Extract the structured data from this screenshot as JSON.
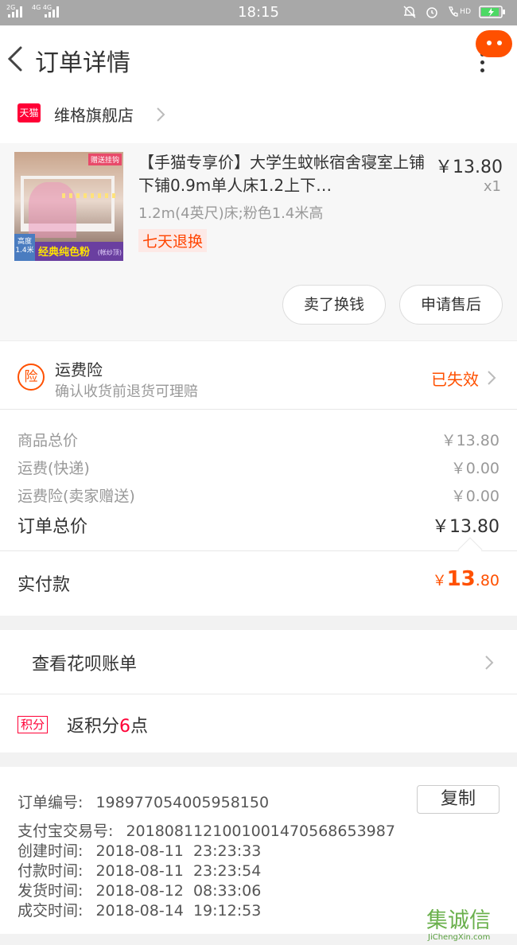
{
  "status_bar": {
    "sig1": "2G",
    "sig2": "4G 4G",
    "time": "18:15",
    "hd": "HD"
  },
  "nav": {
    "title": "订单详情",
    "accent": "#ff5000"
  },
  "shop": {
    "badge": "天猫",
    "name": "维格旗舰店"
  },
  "item": {
    "title": "【手猫专享价】大学生蚊帐宿舍寝室上铺下铺0.9m单人床1.2上下…",
    "sku": "1.2m(4英尺)床;粉色1.4米高",
    "tag": "七天退换",
    "price": "￥13.80",
    "qty": "x1",
    "thumb": {
      "gift": "赠送挂钩",
      "band": "经典纯色粉",
      "band_small": "(帐纱顶)",
      "height": "高度 1.4米"
    },
    "buttons": {
      "sell": "卖了换钱",
      "service": "申请售后"
    }
  },
  "insurance": {
    "icon": "险",
    "title": "运费险",
    "subtitle": "确认收货前退货可理赔",
    "status": "已失效"
  },
  "summary": {
    "rows": [
      {
        "label": "商品总价",
        "value": "￥13.80"
      },
      {
        "label": "运费(快递)",
        "value": "￥0.00"
      },
      {
        "label": "运费险(卖家赠送)",
        "value": "￥0.00"
      }
    ],
    "total_label": "订单总价",
    "total_value": "￥13.80"
  },
  "paid": {
    "label": "实付款",
    "yen": "￥",
    "int": "13",
    "dec": ".80"
  },
  "huabei": {
    "label": "查看花呗账单"
  },
  "points": {
    "badge": "积分",
    "prefix": "返积分",
    "num": "6",
    "suffix": "点"
  },
  "order_info": {
    "copy_label": "复制",
    "rows": [
      {
        "label": "订单编号:",
        "value": "198977054005958150"
      },
      {
        "label": "支付宝交易号:",
        "value": "2018081121001001470568653987"
      },
      {
        "label": "创建时间:",
        "value": "2018-08-11  23:23:33"
      },
      {
        "label": "付款时间:",
        "value": "2018-08-11  23:23:54"
      },
      {
        "label": "发货时间:",
        "value": "2018-08-12  08:33:06"
      },
      {
        "label": "成交时间:",
        "value": "2018-08-14  19:12:53"
      }
    ]
  },
  "watermark": {
    "logo": "集诚信",
    "sub": "JiChengXin.com"
  }
}
